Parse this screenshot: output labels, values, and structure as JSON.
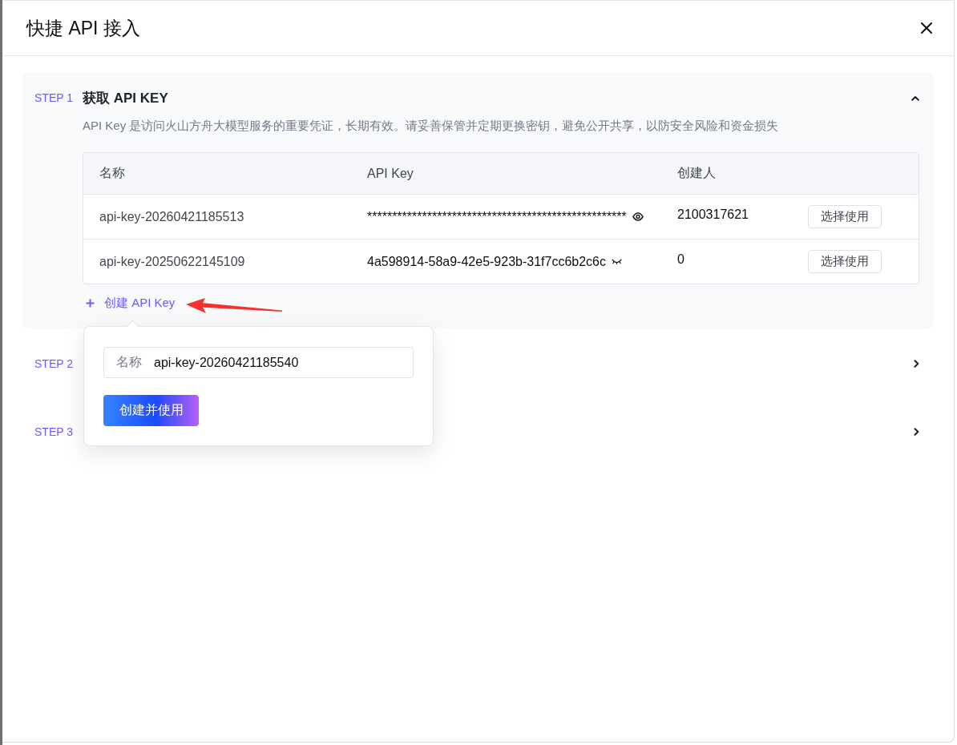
{
  "dialog": {
    "title": "快捷 API 接入"
  },
  "steps": [
    {
      "label": "STEP 1",
      "title": "获取 API KEY",
      "expanded": true,
      "description": "API Key 是访问火山方舟大模型服务的重要凭证，长期有效。请妥善保管并定期更换密钥，避免公开共享，以防安全风险和资金损失",
      "table": {
        "columns": [
          "名称",
          "API Key",
          "创建人"
        ],
        "rows": [
          {
            "name": "api-key-20260421185513",
            "key": "****************************************************",
            "revealed": false,
            "creator": "2100317621",
            "action": "选择使用"
          },
          {
            "name": "api-key-20250622145109",
            "key": "4a598914-58a9-42e5-923b-31f7cc6b2c6c",
            "revealed": true,
            "creator": "0",
            "action": "选择使用"
          }
        ]
      },
      "create_link": "创建 API Key"
    },
    {
      "label": "STEP 2",
      "expanded": false
    },
    {
      "label": "STEP 3",
      "expanded": false
    }
  ],
  "create_popover": {
    "field_label": "名称",
    "value": "api-key-20260421185540",
    "submit": "创建并使用"
  }
}
